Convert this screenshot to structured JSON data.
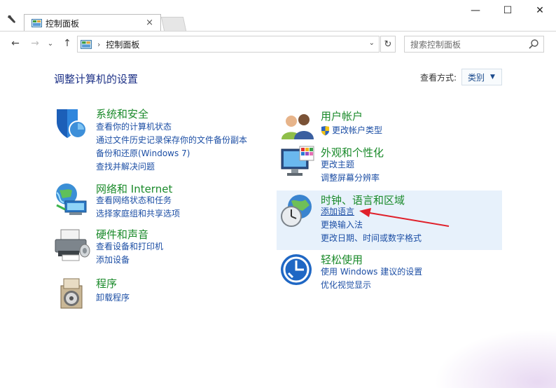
{
  "window": {
    "tab_title": "控制面板",
    "tab_close": "×",
    "minimize": "—",
    "maximize": "☐",
    "close": "✕"
  },
  "nav": {
    "back": "←",
    "forward": "→",
    "dropdown": "⌄",
    "up": "↑",
    "breadcrumb": "控制面板",
    "breadcrumb_sep": "›",
    "address_dropdown": "⌄",
    "refresh": "↻",
    "search_placeholder": "搜索控制面板"
  },
  "page": {
    "heading": "调整计算机的设置",
    "view_by_label": "查看方式:",
    "view_by_value": "类别"
  },
  "categories": {
    "security": {
      "title": "系统和安全",
      "links": [
        "查看你的计算机状态",
        "通过文件历史记录保存你的文件备份副本",
        "备份和还原(Windows 7)",
        "查找并解决问题"
      ]
    },
    "network": {
      "title": "网络和 Internet",
      "links": [
        "查看网络状态和任务",
        "选择家庭组和共享选项"
      ]
    },
    "hardware": {
      "title": "硬件和声音",
      "links": [
        "查看设备和打印机",
        "添加设备"
      ]
    },
    "programs": {
      "title": "程序",
      "links": [
        "卸载程序"
      ]
    },
    "users": {
      "title": "用户帐户",
      "links": [
        "更改帐户类型"
      ]
    },
    "appearance": {
      "title": "外观和个性化",
      "links": [
        "更改主题",
        "调整屏幕分辨率"
      ]
    },
    "clock": {
      "title": "时钟、语言和区域",
      "links": [
        "添加语言",
        "更换输入法",
        "更改日期、时间或数字格式"
      ]
    },
    "ease": {
      "title": "轻松使用",
      "links": [
        "使用 Windows 建议的设置",
        "优化视觉显示"
      ]
    }
  },
  "colors": {
    "category_title": "#1a8a2a",
    "link": "#1d4fa5",
    "heading": "#1e3287",
    "highlight": "#e7f1fb",
    "annotation_arrow": "#e0202a"
  }
}
